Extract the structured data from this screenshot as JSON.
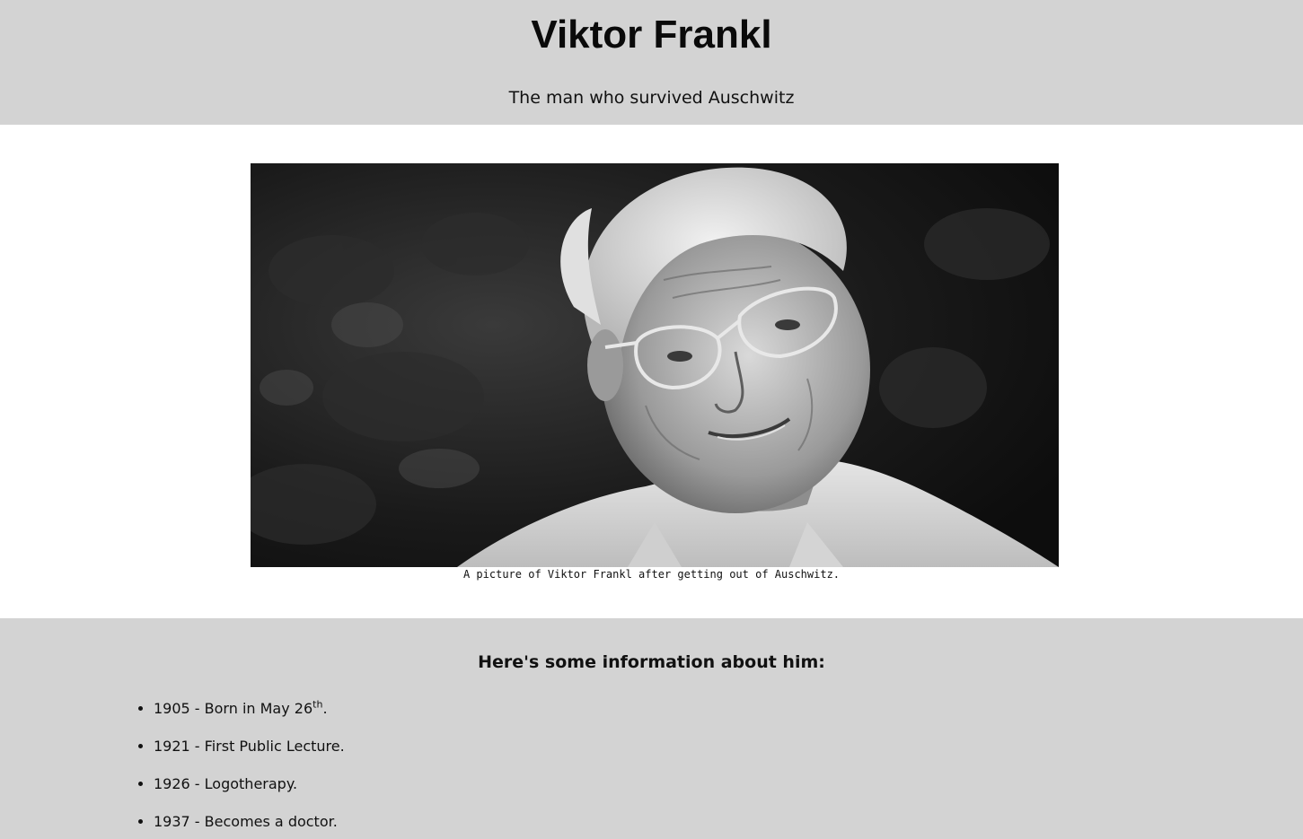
{
  "header": {
    "title": "Viktor Frankl",
    "subtitle": "The man who survived Auschwitz"
  },
  "photo": {
    "alt": "Viktor Frankl portrait",
    "caption": "A picture of Viktor Frankl after getting out of Auschwitz."
  },
  "info": {
    "heading": "Here's some information about him:",
    "items": [
      {
        "text": "1905 - Born in May 26",
        "sup": "th",
        "suffix": "."
      },
      {
        "text": "1921 - First Public Lecture."
      },
      {
        "text": "1926 - Logotherapy."
      },
      {
        "text": "1937 - Becomes a doctor."
      }
    ]
  },
  "colors": {
    "band": "#d3d3d3",
    "photo_bg": "#111111"
  }
}
